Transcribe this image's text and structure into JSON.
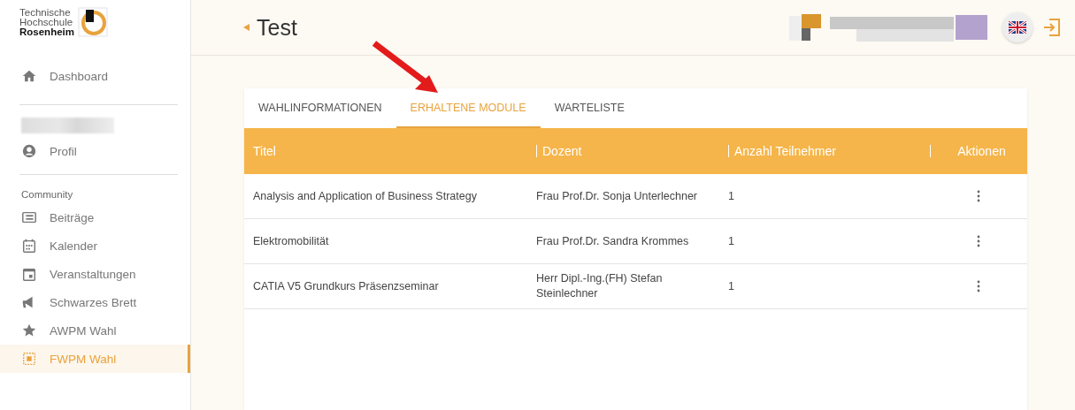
{
  "logo": {
    "lines": [
      "Technische",
      "Hochschule",
      "Rosenheim"
    ]
  },
  "sidebar": {
    "top": [
      {
        "label": "Dashboard",
        "selected": false
      }
    ],
    "profile": {
      "label": "Profil",
      "selected": false
    },
    "section": "Community",
    "items": [
      {
        "label": "Beiträge",
        "selected": false
      },
      {
        "label": "Kalender",
        "selected": false
      },
      {
        "label": "Veranstaltungen",
        "selected": false
      },
      {
        "label": "Schwarzes Brett",
        "selected": false
      },
      {
        "label": "AWPM Wahl",
        "selected": false
      },
      {
        "label": "FWPM Wahl",
        "selected": true
      }
    ]
  },
  "header": {
    "title": "Test"
  },
  "tabs": [
    {
      "label": "WAHLINFORMATIONEN",
      "selected": false
    },
    {
      "label": "ERHALTENE MODULE",
      "selected": true
    },
    {
      "label": "WARTELISTE",
      "selected": false
    }
  ],
  "table": {
    "columns": [
      "Titel",
      "Dozent",
      "Anzahl Teilnehmer",
      "Aktionen"
    ],
    "rows": [
      [
        "Analysis and Application of Business Strategy",
        "Frau Prof.Dr. Sonja Unterlechner",
        "1"
      ],
      [
        "Elektromobilität",
        "Frau Prof.Dr. Sandra Krommes",
        "1"
      ],
      [
        "CATIA V5 Grundkurs Präsenzseminar",
        "Herr Dipl.-Ing.(FH) Stefan Steinlechner",
        "1"
      ]
    ]
  }
}
